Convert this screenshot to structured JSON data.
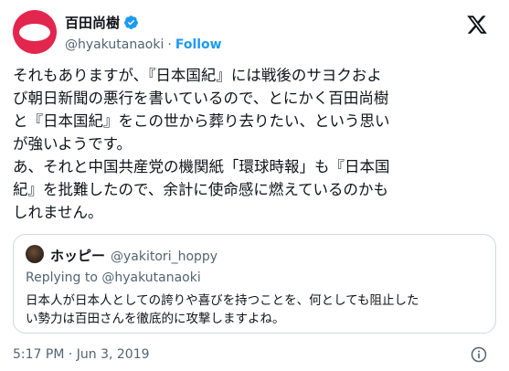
{
  "author": {
    "display_name": "百田尚樹",
    "handle": "@hyakutanaoki",
    "separator": "·",
    "follow_label": "Follow"
  },
  "tweet": {
    "text": "それもありますが、『日本国紀』には戦後のサヨクおよ\nび朝日新聞の悪行を書いているので、とにかく百田尚樹\nと『日本国紀』をこの世から葬り去りたい、という思い\nが強いようです。\nあ、それと中国共産党の機関紙「環球時報」も『日本国\n紀』を批難したので、余計に使命感に燃えているのかも\nしれません。",
    "timestamp": "5:17 PM · Jun 3, 2019"
  },
  "quote": {
    "display_name": "ホッピー",
    "handle": "@yakitori_hoppy",
    "replying_to": "Replying to @hyakutanaoki",
    "text": "日本人が日本人としての誇りや喜びを持つことを、何としても阻止した\nい勢力は百田さんを徹底的に攻撃しますよね。"
  },
  "icons": {
    "avatar": "red-circle-avatar",
    "verified": "verified-badge-icon",
    "logo": "x-logo-icon",
    "info": "info-icon"
  },
  "colors": {
    "accent": "#1d9bf0",
    "avatar_red": "#e2264d",
    "muted": "#536471",
    "text": "#0f1419",
    "border": "#cfd9de"
  }
}
